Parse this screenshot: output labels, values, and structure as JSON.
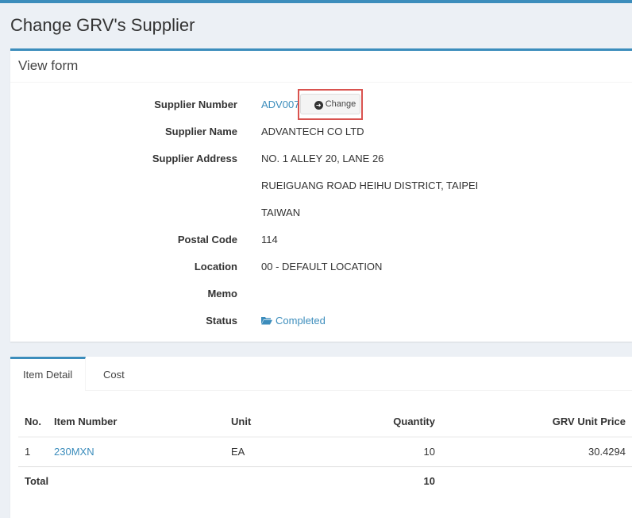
{
  "header": {
    "title": "Change GRV's Supplier"
  },
  "form": {
    "title": "View form",
    "supplier_number_label": "Supplier Number",
    "supplier_number": "ADV007",
    "change_button": "Change",
    "supplier_name_label": "Supplier Name",
    "supplier_name": "ADVANTECH CO LTD",
    "supplier_address_label": "Supplier Address",
    "address_lines": [
      "NO. 1 ALLEY 20, LANE 26",
      "RUEIGUANG ROAD HEIHU DISTRICT, TAIPEI",
      "TAIWAN"
    ],
    "postal_code_label": "Postal Code",
    "postal_code": "114",
    "location_label": "Location",
    "location": "00 - DEFAULT LOCATION",
    "memo_label": "Memo",
    "memo": "",
    "status_label": "Status",
    "status": "Completed"
  },
  "tabs": [
    "Item Detail",
    "Cost"
  ],
  "table": {
    "headers": {
      "no": "No.",
      "item_number": "Item Number",
      "unit": "Unit",
      "quantity": "Quantity",
      "price": "GRV Unit Price"
    },
    "rows": [
      {
        "no": "1",
        "item_number": "230MXN",
        "unit": "EA",
        "quantity": "10",
        "price": "30.4294"
      }
    ],
    "footer": {
      "label": "Total",
      "quantity": "10"
    }
  },
  "colors": {
    "accent": "#3c8dbc",
    "highlight": "#d9534f"
  }
}
